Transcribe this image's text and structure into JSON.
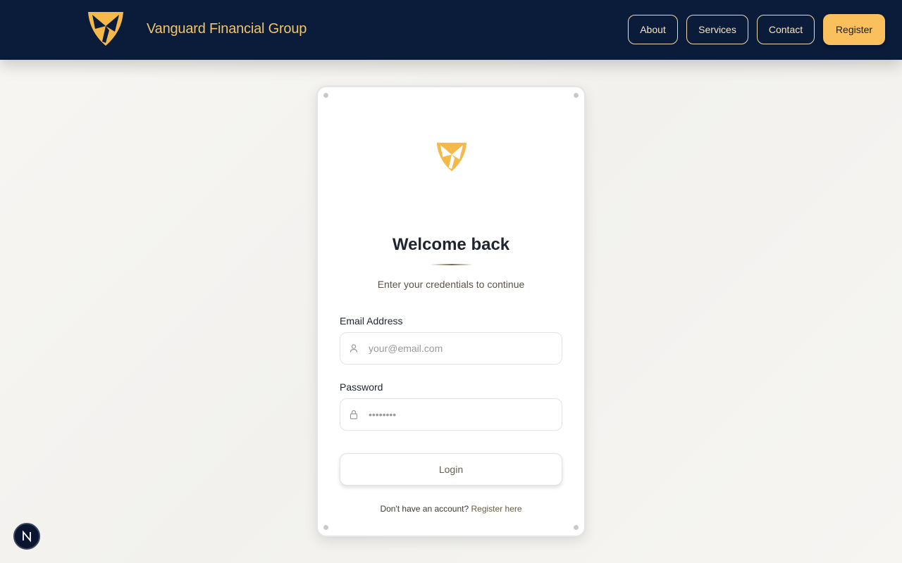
{
  "header": {
    "brand_name": "Vanguard Financial Group",
    "logo_icon": "shield-emblem-icon",
    "nav": {
      "about": "About",
      "services": "Services",
      "contact": "Contact",
      "register": "Register"
    }
  },
  "login_card": {
    "logo_icon": "shield-emblem-icon",
    "title": "Welcome back",
    "subtitle": "Enter your credentials to continue",
    "email": {
      "label": "Email Address",
      "placeholder": "your@email.com",
      "value": "",
      "icon": "user-icon"
    },
    "password": {
      "label": "Password",
      "placeholder": "••••••••",
      "value": "",
      "icon": "lock-icon"
    },
    "login_button": "Login",
    "register_prompt": "Don't have an account?",
    "register_link": "Register here"
  },
  "dev_badge": {
    "label": "N",
    "icon": "nextjs-icon"
  },
  "colors": {
    "navbar": "#0a1c3a",
    "accent_gold": "#fbc05e",
    "brand_text": "#f2c46a"
  }
}
